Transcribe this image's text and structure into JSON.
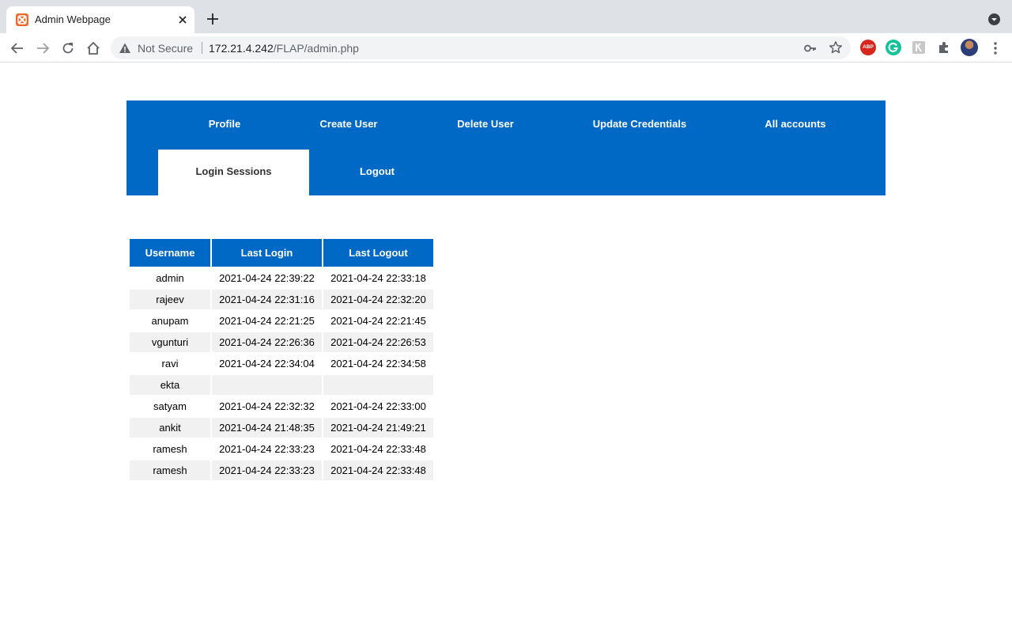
{
  "browser": {
    "tab_title": "Admin Webpage",
    "security_label": "Not Secure",
    "url_host": "172.21.4.242",
    "url_path": "/FLAP/admin.php",
    "extension_abp_label": "ABP"
  },
  "nav": {
    "items": [
      {
        "label": "Profile"
      },
      {
        "label": "Create User"
      },
      {
        "label": "Delete User"
      },
      {
        "label": "Update Credentials"
      },
      {
        "label": "All accounts"
      },
      {
        "label": "Login Sessions",
        "active": true
      },
      {
        "label": "Logout"
      }
    ]
  },
  "sessions": {
    "headers": [
      "Username",
      "Last Login",
      "Last Logout"
    ],
    "rows": [
      [
        "admin",
        "2021-04-24 22:39:22",
        "2021-04-24 22:33:18"
      ],
      [
        "rajeev",
        "2021-04-24 22:31:16",
        "2021-04-24 22:32:20"
      ],
      [
        "anupam",
        "2021-04-24 22:21:25",
        "2021-04-24 22:21:45"
      ],
      [
        "vgunturi",
        "2021-04-24 22:26:36",
        "2021-04-24 22:26:53"
      ],
      [
        "ravi",
        "2021-04-24 22:34:04",
        "2021-04-24 22:34:58"
      ],
      [
        "ekta",
        "",
        ""
      ],
      [
        "satyam",
        "2021-04-24 22:32:32",
        "2021-04-24 22:33:00"
      ],
      [
        "ankit",
        "2021-04-24 21:48:35",
        "2021-04-24 21:49:21"
      ],
      [
        "ramesh",
        "2021-04-24 22:33:23",
        "2021-04-24 22:33:48"
      ],
      [
        "ramesh",
        "2021-04-24 22:33:23",
        "2021-04-24 22:33:48"
      ]
    ]
  },
  "colors": {
    "nav_blue": "#0069c6",
    "row_alt": "#f1f1f1",
    "chrome_bg": "#dee1e6"
  }
}
